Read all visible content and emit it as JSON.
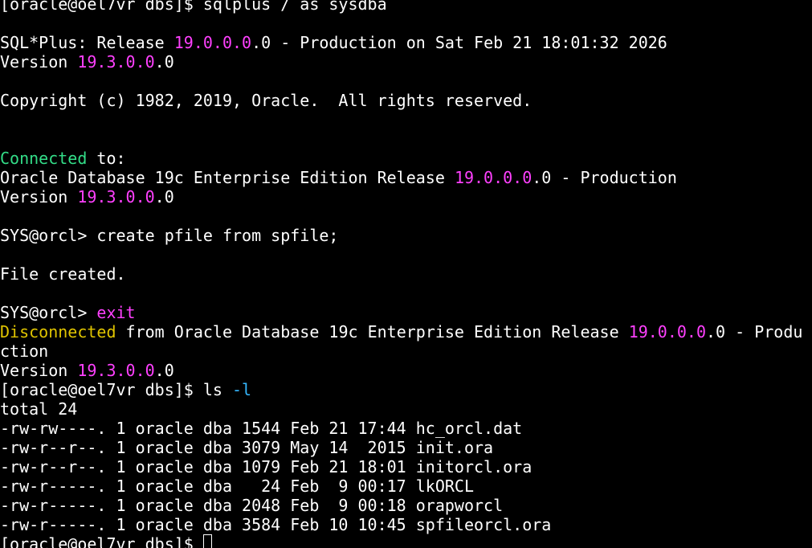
{
  "colors": {
    "background": "#000000",
    "text": "#ffffff",
    "number": "#ff40ff",
    "connected": "#33dd88",
    "disconnected": "#e0c400",
    "command_keyword": "#ff40ff",
    "option": "#35b8ff"
  },
  "terminal": {
    "lines": [
      {
        "segments": [
          {
            "text": "[oracle@oel7vr dbs]$ sqlplus / as sysdba",
            "color": "text"
          }
        ]
      },
      {
        "segments": []
      },
      {
        "segments": [
          {
            "text": "SQL*Plus: Release ",
            "color": "text"
          },
          {
            "text": "19.0.0.0",
            "color": "number"
          },
          {
            "text": ".0 - Production on Sat Feb 21 18:01:32 2026",
            "color": "text"
          }
        ]
      },
      {
        "segments": [
          {
            "text": "Version ",
            "color": "text"
          },
          {
            "text": "19.3.0.0",
            "color": "number"
          },
          {
            "text": ".0",
            "color": "text"
          }
        ]
      },
      {
        "segments": []
      },
      {
        "segments": [
          {
            "text": "Copyright (c) 1982, 2019, Oracle.  All rights reserved.",
            "color": "text"
          }
        ]
      },
      {
        "segments": []
      },
      {
        "segments": []
      },
      {
        "segments": [
          {
            "text": "Connected",
            "color": "connected"
          },
          {
            "text": " to:",
            "color": "text"
          }
        ]
      },
      {
        "segments": [
          {
            "text": "Oracle Database 19c Enterprise Edition Release ",
            "color": "text"
          },
          {
            "text": "19.0.0.0",
            "color": "number"
          },
          {
            "text": ".0 - Production",
            "color": "text"
          }
        ]
      },
      {
        "segments": [
          {
            "text": "Version ",
            "color": "text"
          },
          {
            "text": "19.3.0.0",
            "color": "number"
          },
          {
            "text": ".0",
            "color": "text"
          }
        ]
      },
      {
        "segments": []
      },
      {
        "segments": [
          {
            "text": "SYS@orcl> create pfile from spfile;",
            "color": "text"
          }
        ]
      },
      {
        "segments": []
      },
      {
        "segments": [
          {
            "text": "File created.",
            "color": "text"
          }
        ]
      },
      {
        "segments": []
      },
      {
        "segments": [
          {
            "text": "SYS@orcl> ",
            "color": "text"
          },
          {
            "text": "exit",
            "color": "command_keyword"
          }
        ]
      },
      {
        "segments": [
          {
            "text": "Disconnected",
            "color": "disconnected"
          },
          {
            "text": " from Oracle Database 19c Enterprise Edition Release ",
            "color": "text"
          },
          {
            "text": "19.0.0.0",
            "color": "number"
          },
          {
            "text": ".0 - Produ",
            "color": "text"
          }
        ]
      },
      {
        "segments": [
          {
            "text": "ction",
            "color": "text"
          }
        ]
      },
      {
        "segments": [
          {
            "text": "Version ",
            "color": "text"
          },
          {
            "text": "19.3.0.0",
            "color": "number"
          },
          {
            "text": ".0",
            "color": "text"
          }
        ]
      },
      {
        "segments": [
          {
            "text": "[oracle@oel7vr dbs]$ ls ",
            "color": "text"
          },
          {
            "text": "-l",
            "color": "option"
          }
        ]
      },
      {
        "segments": [
          {
            "text": "total 24",
            "color": "text"
          }
        ]
      },
      {
        "segments": [
          {
            "text": "-rw-rw----. 1 oracle dba 1544 Feb 21 17:44 hc_orcl.dat",
            "color": "text"
          }
        ]
      },
      {
        "segments": [
          {
            "text": "-rw-r--r--. 1 oracle dba 3079 May 14  2015 init.ora",
            "color": "text"
          }
        ]
      },
      {
        "segments": [
          {
            "text": "-rw-r--r--. 1 oracle dba 1079 Feb 21 18:01 initorcl.ora",
            "color": "text"
          }
        ]
      },
      {
        "segments": [
          {
            "text": "-rw-r-----. 1 oracle dba   24 Feb  9 00:17 lkORCL",
            "color": "text"
          }
        ]
      },
      {
        "segments": [
          {
            "text": "-rw-r-----. 1 oracle dba 2048 Feb  9 00:18 orapworcl",
            "color": "text"
          }
        ]
      },
      {
        "segments": [
          {
            "text": "-rw-r-----. 1 oracle dba 3584 Feb 10 10:45 spfileorcl.ora",
            "color": "text"
          }
        ]
      },
      {
        "segments": [
          {
            "text": "[oracle@oel7vr dbs]$ ",
            "color": "text"
          }
        ],
        "cursor": true
      }
    ]
  }
}
